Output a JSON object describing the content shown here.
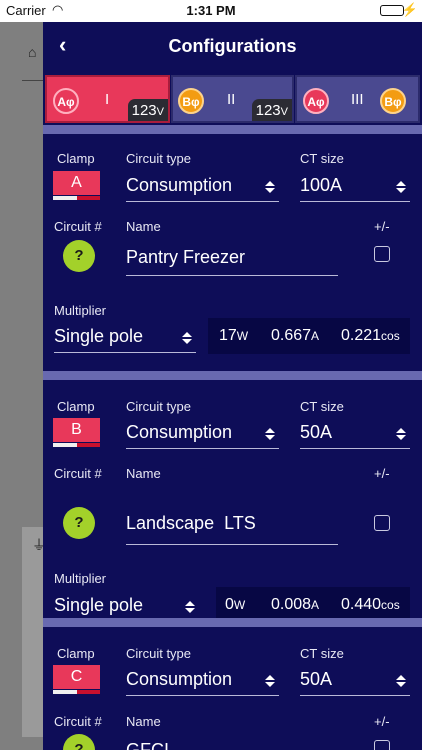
{
  "status": {
    "carrier": "Carrier",
    "time": "1:31 PM"
  },
  "nav": {
    "title": "Configurations"
  },
  "phases": [
    {
      "roman": "I",
      "voltage": "123",
      "unit": "V",
      "left_badge": "Aφ",
      "selected": true
    },
    {
      "roman": "II",
      "voltage": "123",
      "unit": "V",
      "left_badge": "Bφ",
      "selected": false
    },
    {
      "roman": "III",
      "left_badge": "Aφ",
      "right_badge": "Bφ",
      "selected": false
    }
  ],
  "labels": {
    "clamp": "Clamp",
    "circuit_type": "Circuit type",
    "ct_size": "CT size",
    "circuit_num": "Circuit #",
    "name": "Name",
    "plus_minus": "+/-",
    "multiplier": "Multiplier"
  },
  "circuits": [
    {
      "clamp": "A",
      "circuit_type": "Consumption",
      "ct_size": "100A",
      "circuit_num": "?",
      "name": "Pantry Freezer",
      "multiplier": "Single pole",
      "watts": "17",
      "amps": "0.667",
      "cos": "0.221"
    },
    {
      "clamp": "B",
      "circuit_type": "Consumption",
      "ct_size": "50A",
      "circuit_num": "?",
      "name": "Landscape  LTS",
      "multiplier": "Single pole",
      "watts": "0",
      "amps": "0.008",
      "cos": "0.440"
    },
    {
      "clamp": "C",
      "circuit_type": "Consumption",
      "ct_size": "50A",
      "circuit_num": "?",
      "name": "GFCI"
    }
  ],
  "units": {
    "w": "W",
    "a": "A",
    "cos": "cos"
  },
  "colors": {
    "panel": "#0e0d58",
    "accent_red": "#e8385a",
    "phase_b": "#f39c12",
    "question": "#a3d12a"
  }
}
